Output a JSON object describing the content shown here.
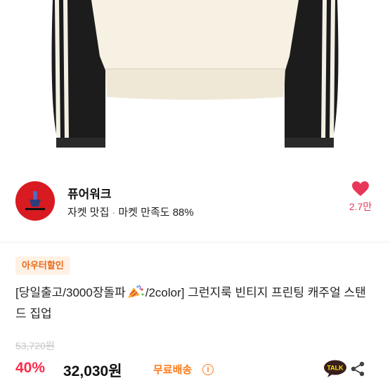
{
  "store": {
    "name": "퓨어워크",
    "tag": "자켓 맛집",
    "separator": "·",
    "rating": "마켓 만족도 88%",
    "likes": "2.7만"
  },
  "product": {
    "badge": "아우터할인",
    "title_part1": "[당일출고/3000장돌파",
    "title_part2": "/2color] 그런지룩 빈티지 프린팅 캐주얼 스탠드 집업",
    "original_price": "53,720원",
    "discount": "40%",
    "price": "32,030원",
    "shipping": "무료배송",
    "talk_label": "TALK"
  },
  "colors": {
    "accent_red": "#ff2a48",
    "like_pink": "#e8385a",
    "shipping_orange": "#ff7a1a",
    "badge_bg": "#fff1e4",
    "logo_red": "#d81a21"
  },
  "icons": [
    "heart-icon",
    "info-icon",
    "kakao-talk-icon",
    "share-icon",
    "party-popper-icon"
  ]
}
